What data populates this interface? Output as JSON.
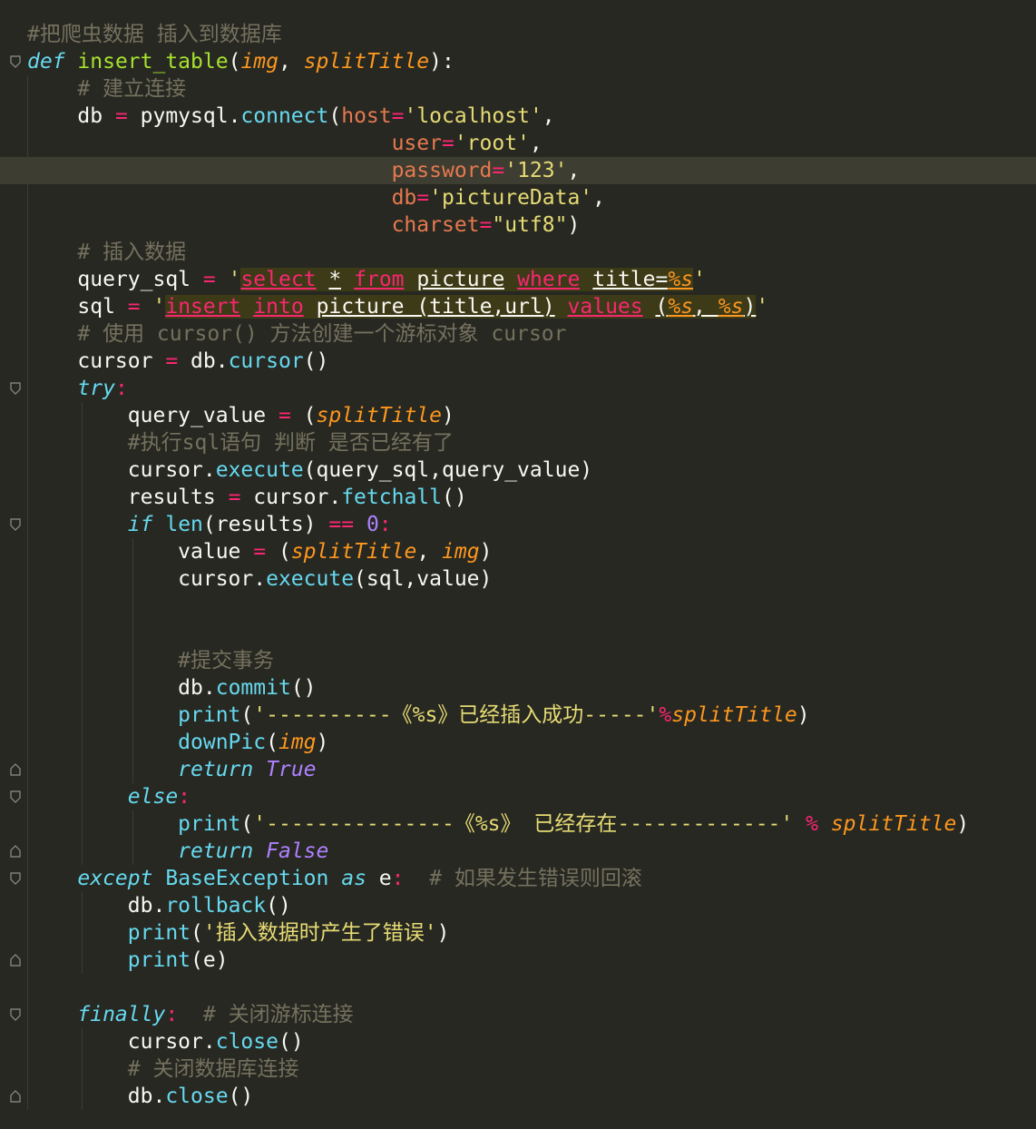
{
  "editor": {
    "background": "#272822",
    "active_line": 7,
    "colors": {
      "comment": "#75715E",
      "keyword": "#F92672",
      "storage": "#66D9EF",
      "function": "#A6E22E",
      "param": "#FD971F",
      "string": "#E6DB74",
      "kwarg": "#E5794F",
      "number": "#AE81FF"
    },
    "lines": [
      {
        "indent": 0,
        "fold": false,
        "tokens": [
          {
            "t": "#把爬虫数据 插入到数据库",
            "c": "c"
          }
        ]
      },
      {
        "indent": 0,
        "fold": "open",
        "tokens": [
          {
            "t": "def",
            "c": "kb"
          },
          {
            "t": " ",
            "c": "w"
          },
          {
            "t": "insert_table",
            "c": "fn"
          },
          {
            "t": "(",
            "c": "w"
          },
          {
            "t": "img",
            "c": "pa"
          },
          {
            "t": ", ",
            "c": "w"
          },
          {
            "t": "splitTitle",
            "c": "pa"
          },
          {
            "t": "):",
            "c": "w"
          }
        ]
      },
      {
        "indent": 1,
        "fold": false,
        "tokens": [
          {
            "t": "# 建立连接",
            "c": "c"
          }
        ]
      },
      {
        "indent": 1,
        "fold": false,
        "tokens": [
          {
            "t": "db ",
            "c": "w"
          },
          {
            "t": "=",
            "c": "k"
          },
          {
            "t": " pymysql.",
            "c": "w"
          },
          {
            "t": "connect",
            "c": "mt"
          },
          {
            "t": "(",
            "c": "w"
          },
          {
            "t": "host",
            "c": "kw"
          },
          {
            "t": "=",
            "c": "k"
          },
          {
            "t": "'localhost'",
            "c": "st"
          },
          {
            "t": ",",
            "c": "w"
          }
        ]
      },
      {
        "indent": 1,
        "fold": false,
        "pad": "                         ",
        "tokens": [
          {
            "t": "user",
            "c": "kw"
          },
          {
            "t": "=",
            "c": "k"
          },
          {
            "t": "'root'",
            "c": "st"
          },
          {
            "t": ",",
            "c": "w"
          }
        ]
      },
      {
        "indent": 1,
        "fold": false,
        "pad": "                         ",
        "tokens": [
          {
            "t": "password",
            "c": "kw"
          },
          {
            "t": "=",
            "c": "k"
          },
          {
            "t": "'123'",
            "c": "st"
          },
          {
            "t": ",",
            "c": "w"
          }
        ]
      },
      {
        "indent": 1,
        "fold": false,
        "pad": "                         ",
        "tokens": [
          {
            "t": "db",
            "c": "kw"
          },
          {
            "t": "=",
            "c": "k"
          },
          {
            "t": "'pictureData'",
            "c": "st"
          },
          {
            "t": ",",
            "c": "w"
          }
        ]
      },
      {
        "indent": 1,
        "fold": false,
        "pad": "                         ",
        "tokens": [
          {
            "t": "charset",
            "c": "kw"
          },
          {
            "t": "=",
            "c": "k"
          },
          {
            "t": "\"utf8\"",
            "c": "st"
          },
          {
            "t": ")",
            "c": "w"
          }
        ]
      },
      {
        "indent": 1,
        "fold": false,
        "tokens": [
          {
            "t": "# 插入数据",
            "c": "c"
          }
        ]
      },
      {
        "indent": 1,
        "fold": false,
        "tokens": [
          {
            "t": "query_sql ",
            "c": "w"
          },
          {
            "t": "=",
            "c": "k"
          },
          {
            "t": " ",
            "c": "w"
          },
          {
            "t": "'",
            "c": "st"
          },
          {
            "t": "select",
            "c": "sqlk",
            "bg": true
          },
          {
            "t": " ",
            "c": "w",
            "bg": true
          },
          {
            "t": "*",
            "c": "sqlt",
            "bg": true
          },
          {
            "t": " ",
            "c": "w",
            "bg": true
          },
          {
            "t": "from",
            "c": "sqlk",
            "bg": true
          },
          {
            "t": " ",
            "c": "w",
            "bg": true
          },
          {
            "t": "picture",
            "c": "sqlt",
            "bg": true
          },
          {
            "t": " ",
            "c": "w",
            "bg": true
          },
          {
            "t": "where",
            "c": "sqlk",
            "bg": true
          },
          {
            "t": " ",
            "c": "w",
            "bg": true
          },
          {
            "t": "title=",
            "c": "sqlt",
            "bg": true
          },
          {
            "t": "%s",
            "c": "sqlp",
            "bg": true
          },
          {
            "t": "'",
            "c": "st"
          }
        ]
      },
      {
        "indent": 1,
        "fold": false,
        "tokens": [
          {
            "t": "sql ",
            "c": "w"
          },
          {
            "t": "=",
            "c": "k"
          },
          {
            "t": " ",
            "c": "w"
          },
          {
            "t": "'",
            "c": "st"
          },
          {
            "t": "insert",
            "c": "sqlk",
            "bg": true
          },
          {
            "t": " ",
            "c": "w",
            "bg": true
          },
          {
            "t": "into",
            "c": "sqlk",
            "bg": true
          },
          {
            "t": " ",
            "c": "w",
            "bg": true
          },
          {
            "t": "picture (title,url)",
            "c": "sqlt",
            "bg": true
          },
          {
            "t": " ",
            "c": "w",
            "bg": true
          },
          {
            "t": "values",
            "c": "sqlk",
            "bg": true
          },
          {
            "t": " ",
            "c": "w",
            "bg": true
          },
          {
            "t": "(",
            "c": "sqlt",
            "bg": true
          },
          {
            "t": "%s",
            "c": "sqlp",
            "bg": true
          },
          {
            "t": ", ",
            "c": "sqlt",
            "bg": true
          },
          {
            "t": "%s",
            "c": "sqlp",
            "bg": true
          },
          {
            "t": ")",
            "c": "sqlt",
            "bg": true
          },
          {
            "t": "'",
            "c": "st"
          }
        ]
      },
      {
        "indent": 1,
        "fold": false,
        "tokens": [
          {
            "t": "# 使用 cursor() 方法创建一个游标对象 cursor",
            "c": "c"
          }
        ]
      },
      {
        "indent": 1,
        "fold": false,
        "tokens": [
          {
            "t": "cursor ",
            "c": "w"
          },
          {
            "t": "=",
            "c": "k"
          },
          {
            "t": " db.",
            "c": "w"
          },
          {
            "t": "cursor",
            "c": "mt"
          },
          {
            "t": "()",
            "c": "w"
          }
        ]
      },
      {
        "indent": 1,
        "fold": "open",
        "tokens": [
          {
            "t": "try",
            "c": "kb"
          },
          {
            "t": ":",
            "c": "k"
          }
        ]
      },
      {
        "indent": 2,
        "fold": false,
        "tokens": [
          {
            "t": "query_value ",
            "c": "w"
          },
          {
            "t": "=",
            "c": "k"
          },
          {
            "t": " (",
            "c": "w"
          },
          {
            "t": "splitTitle",
            "c": "pa"
          },
          {
            "t": ")",
            "c": "w"
          }
        ]
      },
      {
        "indent": 2,
        "fold": false,
        "tokens": [
          {
            "t": "#执行sql语句 判断 是否已经有了",
            "c": "c"
          }
        ]
      },
      {
        "indent": 2,
        "fold": false,
        "tokens": [
          {
            "t": "cursor.",
            "c": "w"
          },
          {
            "t": "execute",
            "c": "mt"
          },
          {
            "t": "(query_sql,query_value)",
            "c": "w"
          }
        ]
      },
      {
        "indent": 2,
        "fold": false,
        "tokens": [
          {
            "t": "results ",
            "c": "w"
          },
          {
            "t": "=",
            "c": "k"
          },
          {
            "t": " cursor.",
            "c": "w"
          },
          {
            "t": "fetchall",
            "c": "mt"
          },
          {
            "t": "()",
            "c": "w"
          }
        ]
      },
      {
        "indent": 2,
        "fold": "open",
        "tokens": [
          {
            "t": "if",
            "c": "kb"
          },
          {
            "t": " ",
            "c": "w"
          },
          {
            "t": "len",
            "c": "mt"
          },
          {
            "t": "(results) ",
            "c": "w"
          },
          {
            "t": "==",
            "c": "k"
          },
          {
            "t": " ",
            "c": "w"
          },
          {
            "t": "0",
            "c": "nm"
          },
          {
            "t": ":",
            "c": "k"
          }
        ]
      },
      {
        "indent": 3,
        "fold": false,
        "tokens": [
          {
            "t": "value ",
            "c": "w"
          },
          {
            "t": "=",
            "c": "k"
          },
          {
            "t": " (",
            "c": "w"
          },
          {
            "t": "splitTitle",
            "c": "pa"
          },
          {
            "t": ", ",
            "c": "w"
          },
          {
            "t": "img",
            "c": "pa"
          },
          {
            "t": ")",
            "c": "w"
          }
        ]
      },
      {
        "indent": 3,
        "fold": false,
        "tokens": [
          {
            "t": "cursor.",
            "c": "w"
          },
          {
            "t": "execute",
            "c": "mt"
          },
          {
            "t": "(sql,value)",
            "c": "w"
          }
        ]
      },
      {
        "indent": 3,
        "fold": false,
        "tokens": []
      },
      {
        "indent": 3,
        "fold": false,
        "tokens": []
      },
      {
        "indent": 3,
        "fold": false,
        "tokens": [
          {
            "t": "#提交事务",
            "c": "c"
          }
        ]
      },
      {
        "indent": 3,
        "fold": false,
        "tokens": [
          {
            "t": "db.",
            "c": "w"
          },
          {
            "t": "commit",
            "c": "mt"
          },
          {
            "t": "()",
            "c": "w"
          }
        ]
      },
      {
        "indent": 3,
        "fold": false,
        "tokens": [
          {
            "t": "print",
            "c": "mt"
          },
          {
            "t": "(",
            "c": "w"
          },
          {
            "t": "'----------《%s》已经插入成功-----'",
            "c": "st"
          },
          {
            "t": "%",
            "c": "k"
          },
          {
            "t": "splitTitle",
            "c": "pa"
          },
          {
            "t": ")",
            "c": "w"
          }
        ]
      },
      {
        "indent": 3,
        "fold": false,
        "tokens": [
          {
            "t": "downPic",
            "c": "mt"
          },
          {
            "t": "(",
            "c": "w"
          },
          {
            "t": "img",
            "c": "pa"
          },
          {
            "t": ")",
            "c": "w"
          }
        ]
      },
      {
        "indent": 3,
        "fold": "close",
        "tokens": [
          {
            "t": "return",
            "c": "kb"
          },
          {
            "t": " ",
            "c": "w"
          },
          {
            "t": "True",
            "c": "cn"
          }
        ]
      },
      {
        "indent": 2,
        "fold": "open",
        "tokens": [
          {
            "t": "else",
            "c": "kb"
          },
          {
            "t": ":",
            "c": "k"
          }
        ]
      },
      {
        "indent": 3,
        "fold": false,
        "tokens": [
          {
            "t": "print",
            "c": "mt"
          },
          {
            "t": "(",
            "c": "w"
          },
          {
            "t": "'---------------《%s》 已经存在-------------'",
            "c": "st"
          },
          {
            "t": " ",
            "c": "w"
          },
          {
            "t": "%",
            "c": "k"
          },
          {
            "t": " ",
            "c": "w"
          },
          {
            "t": "splitTitle",
            "c": "pa"
          },
          {
            "t": ")",
            "c": "w"
          }
        ]
      },
      {
        "indent": 3,
        "fold": "close",
        "tokens": [
          {
            "t": "return",
            "c": "kb"
          },
          {
            "t": " ",
            "c": "w"
          },
          {
            "t": "False",
            "c": "cn"
          }
        ]
      },
      {
        "indent": 1,
        "fold": "open",
        "tokens": [
          {
            "t": "except",
            "c": "kb"
          },
          {
            "t": " ",
            "c": "w"
          },
          {
            "t": "BaseException",
            "c": "mt"
          },
          {
            "t": " ",
            "c": "w"
          },
          {
            "t": "as",
            "c": "kb"
          },
          {
            "t": " e",
            "c": "w"
          },
          {
            "t": ":",
            "c": "k"
          },
          {
            "t": "  # 如果发生错误则回滚",
            "c": "c"
          }
        ]
      },
      {
        "indent": 2,
        "fold": false,
        "tokens": [
          {
            "t": "db.",
            "c": "w"
          },
          {
            "t": "rollback",
            "c": "mt"
          },
          {
            "t": "()",
            "c": "w"
          }
        ]
      },
      {
        "indent": 2,
        "fold": false,
        "tokens": [
          {
            "t": "print",
            "c": "mt"
          },
          {
            "t": "(",
            "c": "w"
          },
          {
            "t": "'插入数据时产生了错误'",
            "c": "st"
          },
          {
            "t": ")",
            "c": "w"
          }
        ]
      },
      {
        "indent": 2,
        "fold": "close",
        "tokens": [
          {
            "t": "print",
            "c": "mt"
          },
          {
            "t": "(e)",
            "c": "w"
          }
        ]
      },
      {
        "indent": 1,
        "fold": false,
        "tokens": []
      },
      {
        "indent": 1,
        "fold": "open",
        "tokens": [
          {
            "t": "finally",
            "c": "kb"
          },
          {
            "t": ":",
            "c": "k"
          },
          {
            "t": "  # 关闭游标连接",
            "c": "c"
          }
        ]
      },
      {
        "indent": 2,
        "fold": false,
        "tokens": [
          {
            "t": "cursor.",
            "c": "w"
          },
          {
            "t": "close",
            "c": "mt"
          },
          {
            "t": "()",
            "c": "w"
          }
        ]
      },
      {
        "indent": 2,
        "fold": false,
        "tokens": [
          {
            "t": "# 关闭数据库连接",
            "c": "c"
          }
        ]
      },
      {
        "indent": 2,
        "fold": "close",
        "tokens": [
          {
            "t": "db.",
            "c": "w"
          },
          {
            "t": "close",
            "c": "mt"
          },
          {
            "t": "()",
            "c": "w"
          }
        ]
      }
    ]
  }
}
